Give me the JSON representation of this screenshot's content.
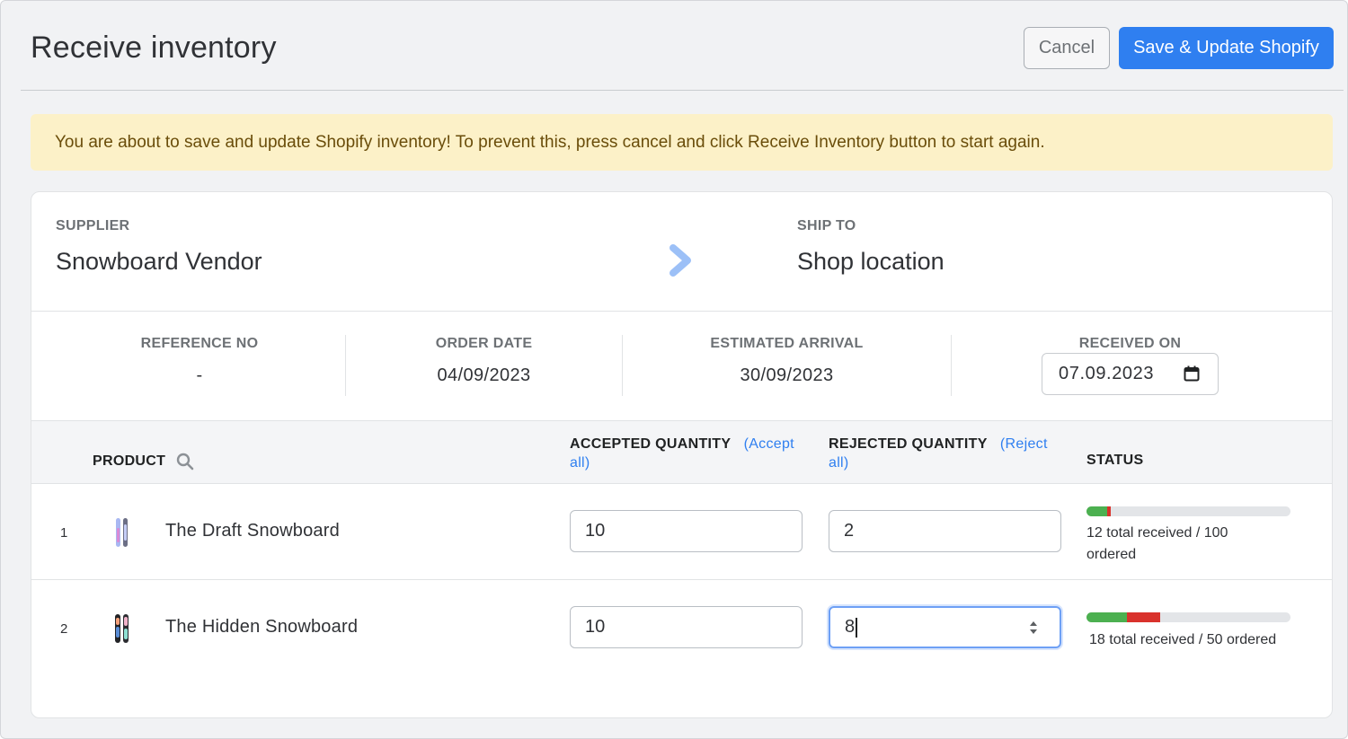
{
  "header": {
    "title": "Receive inventory",
    "cancel_label": "Cancel",
    "save_label": "Save & Update Shopify"
  },
  "banner": {
    "message": "You are about to save and update Shopify inventory! To prevent this, press cancel and click Receive Inventory button to start again."
  },
  "supplier": {
    "label": "SUPPLIER",
    "name": "Snowboard Vendor"
  },
  "ship_to": {
    "label": "SHIP TO",
    "name": "Shop location"
  },
  "meta": {
    "reference": {
      "label": "REFERENCE NO",
      "value": "-"
    },
    "order_date": {
      "label": "ORDER DATE",
      "value": "04/09/2023"
    },
    "estimated_arrival": {
      "label": "ESTIMATED ARRIVAL",
      "value": "30/09/2023"
    },
    "received_on": {
      "label": "RECEIVED ON",
      "value": "07.09.2023"
    }
  },
  "table": {
    "columns": {
      "product": "PRODUCT",
      "accepted": "ACCEPTED QUANTITY",
      "accept_all": "(Accept all)",
      "rejected": "REJECTED QUANTITY",
      "reject_all": "(Reject all)",
      "status": "STATUS"
    },
    "rows": [
      {
        "num": "1",
        "name": "The Draft Snowboard",
        "accepted": "10",
        "rejected": "2",
        "status": "12 total received / 100 ordered",
        "accepted_fraction": 0.1,
        "rejected_fraction": 0.02
      },
      {
        "num": "2",
        "name": "The Hidden Snowboard",
        "accepted": "10",
        "rejected": "8",
        "status": "18 total received / 50 ordered",
        "accepted_fraction": 0.2,
        "rejected_fraction": 0.16
      }
    ]
  },
  "colors": {
    "primary": "#2f7ff0",
    "accepted_bar": "#4cb050",
    "rejected_bar": "#d9322c",
    "banner_bg": "#fcf1c8"
  }
}
